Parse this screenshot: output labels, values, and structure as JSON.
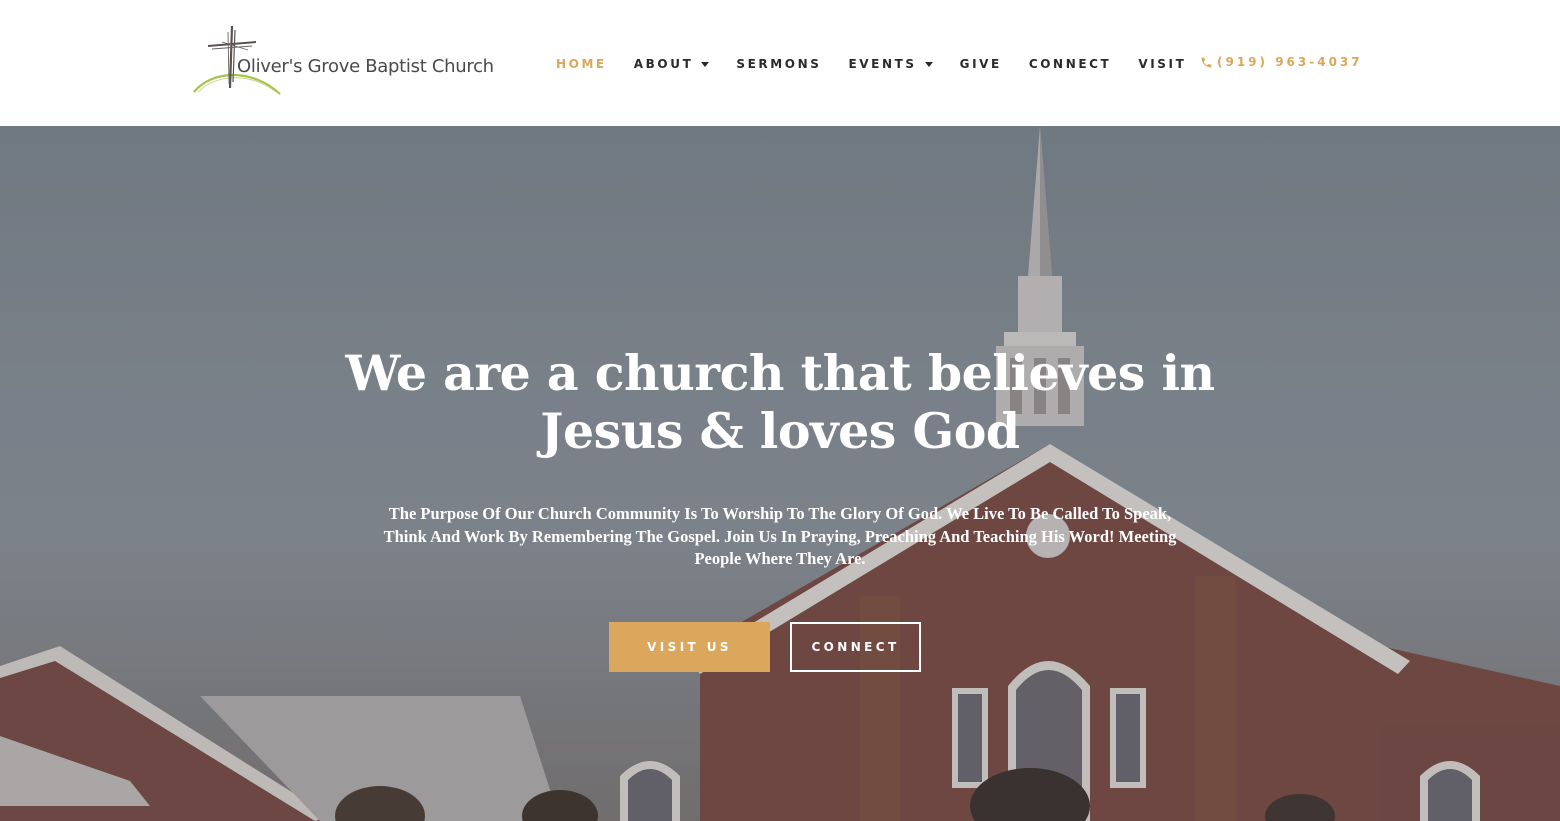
{
  "logo": {
    "text": "Oliver's Grove Baptist Church",
    "icon": "cross-icon"
  },
  "nav": {
    "items": [
      {
        "label": "HOME",
        "active": true
      },
      {
        "label": "ABOUT",
        "dropdown": true
      },
      {
        "label": "SERMONS"
      },
      {
        "label": "EVENTS",
        "dropdown": true
      },
      {
        "label": "GIVE"
      },
      {
        "label": "CONNECT"
      },
      {
        "label": "VISIT"
      }
    ]
  },
  "phone": {
    "icon": "phone-icon",
    "number": "(919) 963-4037"
  },
  "hero": {
    "title_line1": "We are a church that believes in",
    "title_line2": "Jesus & loves God",
    "subtitle": "The Purpose Of Our Church Community Is To Worship To The Glory Of God. We Live To Be Called To Speak, Think And Work By Remembering The Gospel. Join Us In Praying, Preaching And Teaching His Word! Meeting People Where They Are.",
    "primary_button": "VISIT US",
    "secondary_button": "CONNECT"
  },
  "colors": {
    "accent": "#dba75c",
    "nav_text": "#2a2a2a",
    "hero_text": "#ffffff"
  }
}
